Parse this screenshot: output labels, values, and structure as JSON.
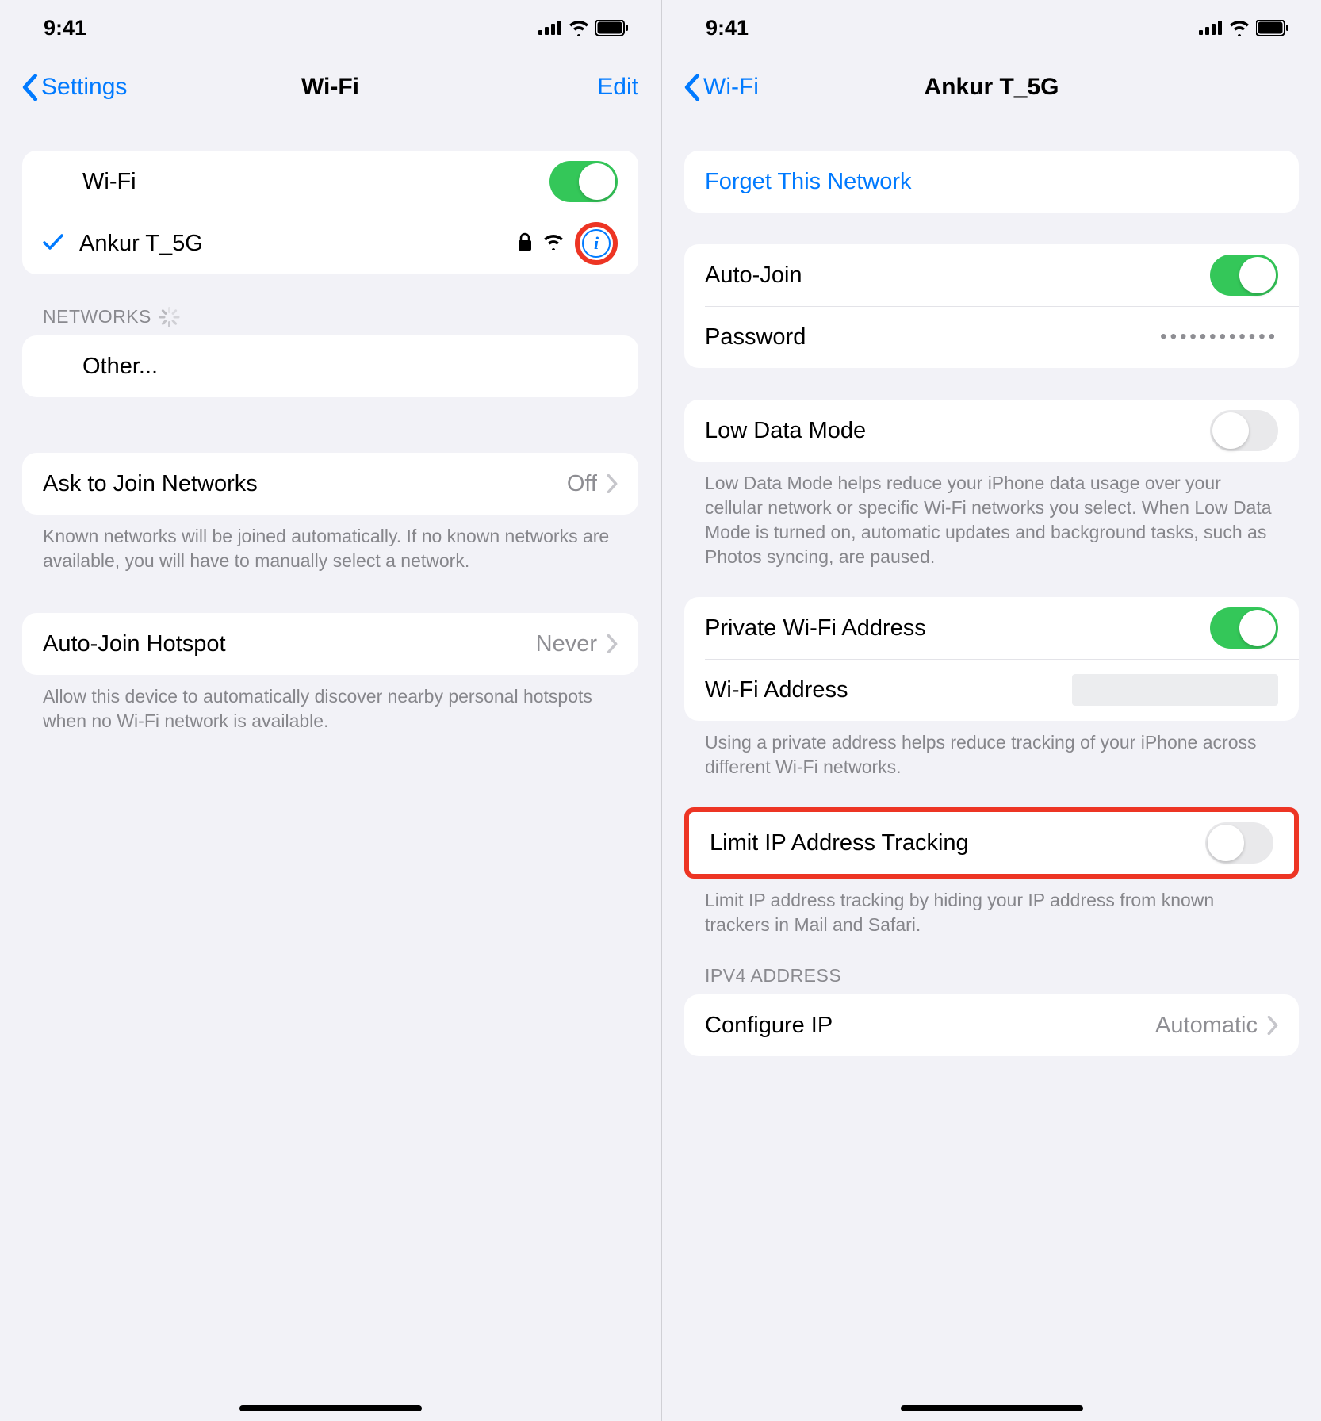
{
  "status": {
    "time": "9:41"
  },
  "left": {
    "back": "Settings",
    "title": "Wi-Fi",
    "edit": "Edit",
    "wifi_label": "Wi-Fi",
    "connected_network": "Ankur T_5G",
    "networks_header": "NETWORKS",
    "other": "Other...",
    "ask_join": {
      "label": "Ask to Join Networks",
      "value": "Off"
    },
    "ask_join_footer": "Known networks will be joined automatically. If no known networks are available, you will have to manually select a network.",
    "auto_hotspot": {
      "label": "Auto-Join Hotspot",
      "value": "Never"
    },
    "auto_hotspot_footer": "Allow this device to automatically discover nearby personal hotspots when no Wi-Fi network is available."
  },
  "right": {
    "back": "Wi-Fi",
    "title": "Ankur T_5G",
    "forget": "Forget This Network",
    "auto_join": "Auto-Join",
    "password_label": "Password",
    "password_value": "••••••••••••",
    "low_data": "Low Data Mode",
    "low_data_footer": "Low Data Mode helps reduce your iPhone data usage over your cellular network or specific Wi-Fi networks you select. When Low Data Mode is turned on, automatic updates and background tasks, such as Photos syncing, are paused.",
    "private_wifi": "Private Wi-Fi Address",
    "wifi_address": "Wi-Fi Address",
    "private_footer": "Using a private address helps reduce tracking of your iPhone across different Wi-Fi networks.",
    "limit_ip": "Limit IP Address Tracking",
    "limit_ip_footer": "Limit IP address tracking by hiding your IP address from known trackers in Mail and Safari.",
    "ipv4_header": "IPV4 ADDRESS",
    "configure_ip": {
      "label": "Configure IP",
      "value": "Automatic"
    }
  }
}
